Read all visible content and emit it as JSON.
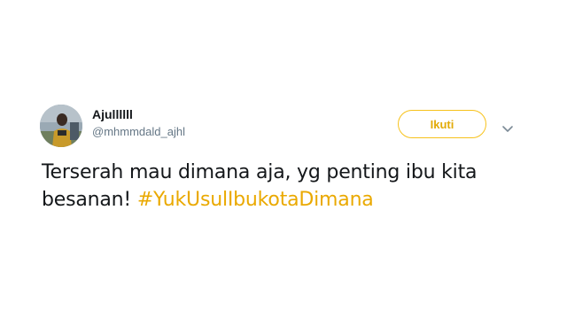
{
  "tweet": {
    "display_name": "Ajullllll",
    "handle": "@mhmmdald_ajhl",
    "follow_label": "Ikuti",
    "text": "Terserah mau dimana aja, yg penting ibu kita besanan! ",
    "hashtag": "#YukUsulIbukotaDimana",
    "avatar_icon": "user-avatar",
    "menu_icon": "chevron-down-icon"
  },
  "colors": {
    "accent": "#f7c21b",
    "hashtag": "#eaa900",
    "text": "#14171a",
    "secondary_text": "#657786"
  }
}
